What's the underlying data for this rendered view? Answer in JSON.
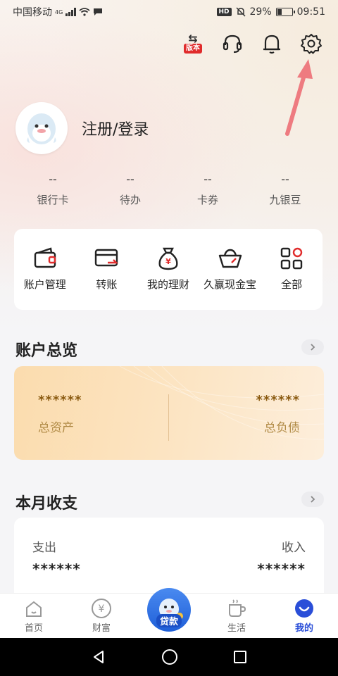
{
  "status_bar": {
    "carrier": "中国移动",
    "network": "4G",
    "hd": "HD",
    "battery": "29%",
    "time": "09:51"
  },
  "header": {
    "version_badge": "版本",
    "icons": [
      "version-switch-icon",
      "headset-icon",
      "bell-icon",
      "gear-icon"
    ]
  },
  "profile": {
    "login_label": "注册/登录"
  },
  "stats": [
    {
      "value": "--",
      "label": "银行卡"
    },
    {
      "value": "--",
      "label": "待办"
    },
    {
      "value": "--",
      "label": "卡券"
    },
    {
      "value": "--",
      "label": "九银豆"
    }
  ],
  "quick_actions": [
    {
      "label": "账户管理",
      "icon": "wallet-icon"
    },
    {
      "label": "转账",
      "icon": "transfer-card-icon"
    },
    {
      "label": "我的理财",
      "icon": "money-bag-icon"
    },
    {
      "label": "久赢现金宝",
      "icon": "gold-ingot-icon"
    },
    {
      "label": "全部",
      "icon": "grid-icon"
    }
  ],
  "account_overview": {
    "title": "账户总览",
    "total_assets_value": "******",
    "total_assets_label": "总资产",
    "total_liabilities_value": "******",
    "total_liabilities_label": "总负债"
  },
  "monthly": {
    "title": "本月收支",
    "expense_label": "支出",
    "expense_value": "******",
    "income_label": "收入",
    "income_value": "******"
  },
  "tab_bar": [
    {
      "label": "首页",
      "icon": "home-icon"
    },
    {
      "label": "财富",
      "icon": "yen-coin-icon"
    },
    {
      "label": "贷款",
      "icon": "loan-mascot-icon"
    },
    {
      "label": "生活",
      "icon": "coffee-cup-icon"
    },
    {
      "label": "我的",
      "icon": "profile-smile-icon",
      "active": true
    }
  ],
  "colors": {
    "accent": "#2a4ed8",
    "brand_red": "#e02b2b",
    "overview_gold": "#fbdcae"
  }
}
